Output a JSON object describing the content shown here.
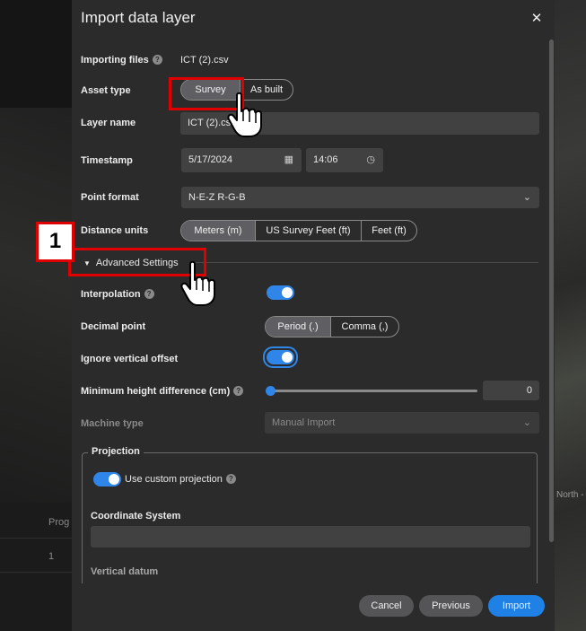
{
  "background": {
    "table_header": "Prog",
    "table_row_1": "1",
    "north_label": "North -"
  },
  "modal": {
    "title": "Import data layer",
    "close_icon": "close-icon"
  },
  "form": {
    "importing_files_label": "Importing files",
    "importing_files_value": "ICT (2).csv",
    "asset_type_label": "Asset type",
    "asset_type_options": [
      "Survey",
      "As built"
    ],
    "asset_type_selected": "Survey",
    "layer_name_label": "Layer name",
    "layer_name_value": "ICT (2).csv",
    "timestamp_label": "Timestamp",
    "timestamp_date": "5/17/2024",
    "timestamp_time": "14:06",
    "point_format_label": "Point format",
    "point_format_value": "N-E-Z R-G-B",
    "distance_units_label": "Distance units",
    "distance_units_options": [
      "Meters (m)",
      "US Survey Feet (ft)",
      "Feet (ft)"
    ],
    "distance_units_selected": "Meters (m)",
    "advanced_settings_label": "Advanced Settings",
    "interpolation_label": "Interpolation",
    "interpolation_on": true,
    "decimal_point_label": "Decimal point",
    "decimal_point_options": [
      "Period (.)",
      "Comma (,)"
    ],
    "decimal_point_selected": "Period (.)",
    "ignore_vertical_offset_label": "Ignore vertical offset",
    "ignore_vertical_offset_on": true,
    "min_height_diff_label": "Minimum height difference (cm)",
    "min_height_diff_value": "0",
    "machine_type_label": "Machine type",
    "machine_type_value": "Manual Import",
    "projection_legend": "Projection",
    "use_custom_projection_label": "Use custom projection",
    "use_custom_projection_on": true,
    "coordinate_system_label": "Coordinate System",
    "coordinate_system_value": "",
    "vertical_datum_label": "Vertical datum"
  },
  "footer": {
    "cancel_label": "Cancel",
    "previous_label": "Previous",
    "import_label": "Import"
  },
  "annotations": {
    "step_number": "1"
  },
  "colors": {
    "accent": "#1f80e6",
    "annotation": "#e00000",
    "modal_bg": "#2b2b2b"
  }
}
